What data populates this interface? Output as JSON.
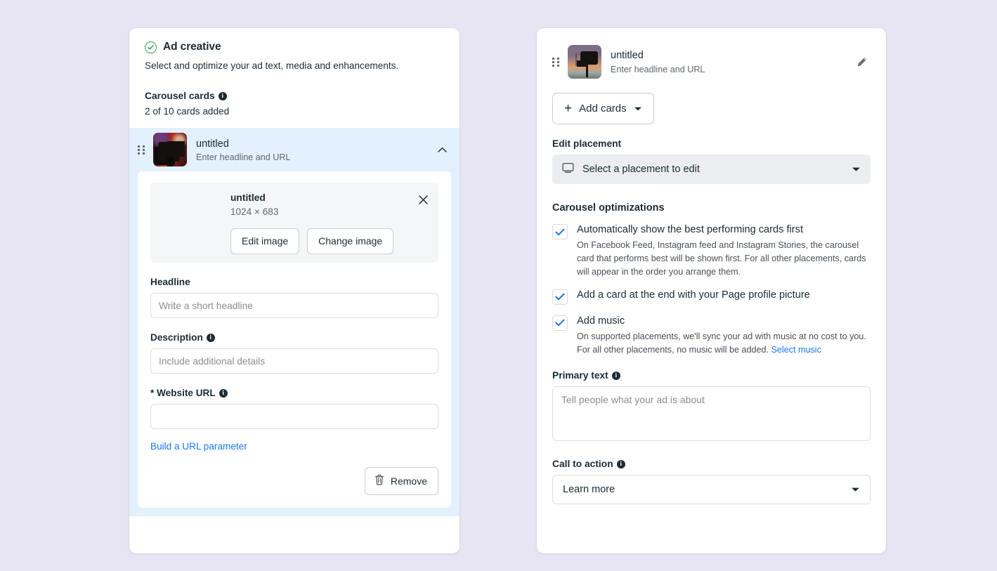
{
  "left_panel": {
    "status_icon": "check-circle-icon",
    "title": "Ad creative",
    "subtitle": "Select and optimize your ad text, media and enhancements.",
    "carousel_cards_label": "Carousel cards",
    "cards_count_text": "2 of 10 cards added",
    "card": {
      "drag_handle": "drag-handle-icon",
      "thumbnail": "studio-camera-thumbnail",
      "title": "untitled",
      "subtitle": "Enter headline and URL",
      "collapse_icon": "chevron-up-icon",
      "media": {
        "thumbnail": "studio-camera-image",
        "name": "untitled",
        "dimensions": "1024 × 683",
        "close_icon": "close-icon",
        "edit_image_label": "Edit image",
        "change_image_label": "Change image"
      },
      "headline_label": "Headline",
      "headline_value": "",
      "headline_placeholder": "Write a short headline",
      "description_label": "Description",
      "description_value": "",
      "description_placeholder": "Include additional details",
      "website_url_label": "* Website URL",
      "website_url_value": "",
      "website_url_placeholder": "",
      "build_url_link": "Build a URL parameter",
      "remove_label": "Remove",
      "remove_icon": "trash-icon"
    }
  },
  "right_panel": {
    "card": {
      "drag_handle": "drag-handle-icon",
      "thumbnail": "sunset-camera-thumbnail",
      "title": "untitled",
      "subtitle": "Enter headline and URL",
      "edit_icon": "pencil-icon"
    },
    "add_cards_label": "Add cards",
    "add_cards_icons": [
      "plus-icon",
      "chevron-down-icon"
    ],
    "edit_placement_label": "Edit placement",
    "placement_select_value": "Select a placement to edit",
    "placement_icon": "monitor-icon",
    "carousel_optimizations_title": "Carousel optimizations",
    "options": [
      {
        "checked": true,
        "title": "Automatically show the best performing cards first",
        "description": "On Facebook Feed, Instagram feed and Instagram Stories, the carousel card that performs best will be shown first. For all other placements, cards will appear in the order you arrange them."
      },
      {
        "checked": true,
        "title": "Add a card at the end with your Page profile picture",
        "description": ""
      },
      {
        "checked": true,
        "title": "Add music",
        "description": "On supported placements, we'll sync your ad with music at no cost to you. For all other placements, no music will be added. ",
        "link_text": "Select music"
      }
    ],
    "primary_text_label": "Primary text",
    "primary_text_value": "",
    "primary_text_placeholder": "Tell people what your ad is about",
    "call_to_action_label": "Call to action",
    "call_to_action_value": "Learn more"
  },
  "colors": {
    "page_background": "#e7e5f3",
    "accent_blue": "#1877f2",
    "success_green": "#31a24c",
    "card_highlight": "#e3f0fd",
    "checkbox_blue": "#1d74e0"
  }
}
